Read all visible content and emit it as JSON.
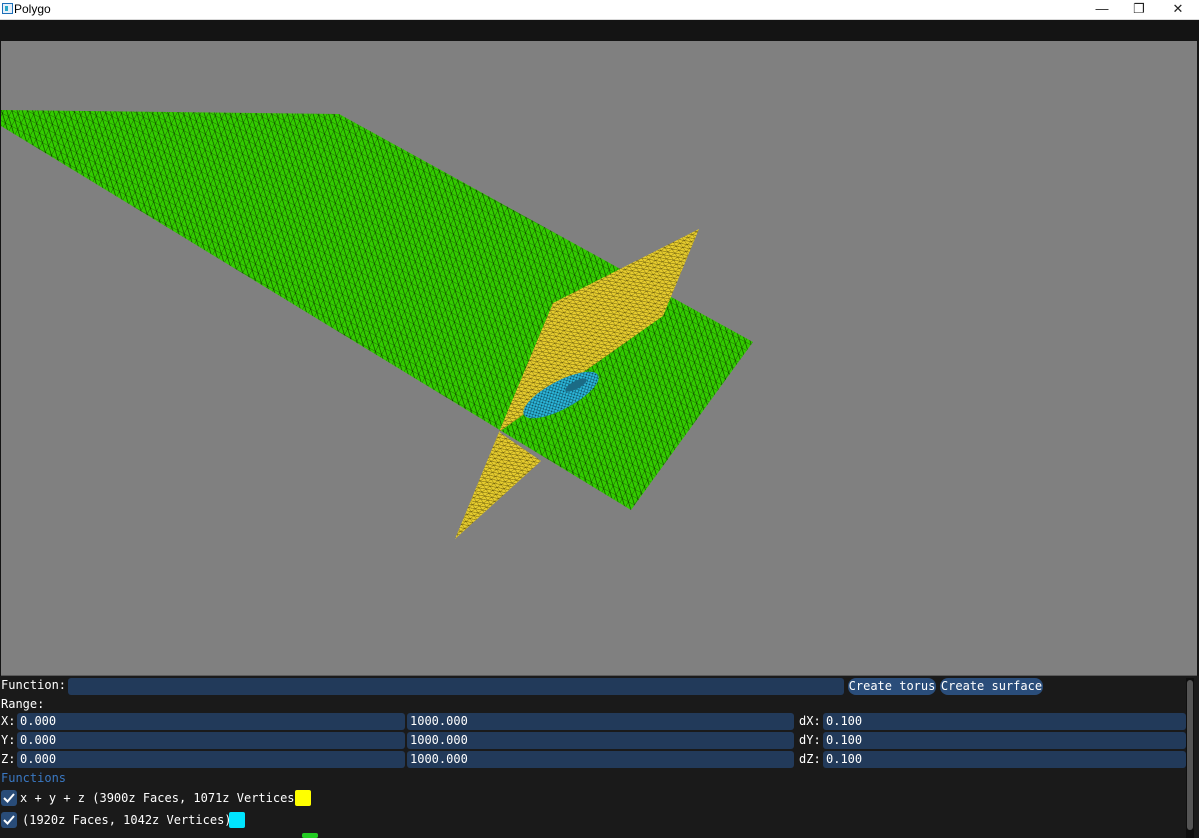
{
  "window": {
    "title": "Polygo",
    "minimize_label": "—",
    "restore_label": "❐",
    "close_label": "✕"
  },
  "panel": {
    "function_label": "Function:",
    "function_value": "",
    "create_torus_label": "Create torus",
    "create_surface_label": "Create surface",
    "range_label": "Range:",
    "rows": [
      {
        "axis": "X:",
        "min": "0.000",
        "max": "1000.000",
        "delta_label": "dX:",
        "delta": "0.100"
      },
      {
        "axis": "Y:",
        "min": "0.000",
        "max": "1000.000",
        "delta_label": "dY:",
        "delta": "0.100"
      },
      {
        "axis": "Z:",
        "min": "0.000",
        "max": "1000.000",
        "delta_label": "dZ:",
        "delta": "0.100"
      }
    ],
    "functions_header": "Functions",
    "functions": [
      {
        "text": "x + y + z (3900z Faces, 1071z Vertices)",
        "checked": true,
        "color": "#ffff00"
      },
      {
        "text": "(1920z Faces, 1042z Vertices)",
        "checked": true,
        "color": "#00e5ff"
      }
    ],
    "third_swatch_color": "#22cc22"
  },
  "scene": {
    "background": "#808080",
    "plane_color": "#33cc00",
    "surface_color": "#e6cc2e",
    "torus_color": "#2ab3d6",
    "wire_color": "#000000"
  }
}
